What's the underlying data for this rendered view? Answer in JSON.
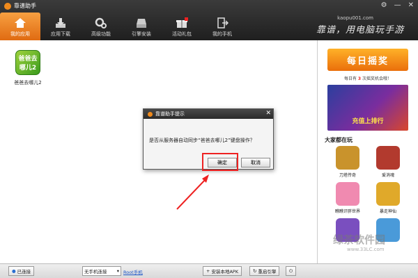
{
  "window": {
    "title": "靠谱助手",
    "controls": [
      "⚙",
      "—",
      "✕"
    ],
    "site": "kaopu001.com",
    "slogan": "靠谱，用电脑玩手游"
  },
  "toolbar": {
    "items": [
      {
        "label": "我的应用",
        "icon": "home-icon",
        "active": true
      },
      {
        "label": "应用下载",
        "icon": "download-icon"
      },
      {
        "label": "高级功能",
        "icon": "gear-icon"
      },
      {
        "label": "引擎安装",
        "icon": "install-icon"
      },
      {
        "label": "活动礼包",
        "icon": "gift-icon"
      },
      {
        "label": "我的手机",
        "icon": "phone-exit-icon"
      }
    ]
  },
  "apps": [
    {
      "name": "爸爸去哪儿2",
      "icon_text": "爸爸去哪儿2"
    }
  ],
  "dialog": {
    "title": "靠谱助手提示",
    "message": "是否从服务器自动同步“爸爸去哪儿2”键盘操作？",
    "ok": "确定",
    "cancel": "取消"
  },
  "sidebar": {
    "daily_button": "每日摇奖",
    "daily_note_prefix": "每日有",
    "daily_note_count": "3",
    "daily_note_suffix": "次摇奖机会哦！",
    "banner_text": "充值上排行",
    "popular_heading": "大家都在玩",
    "games": [
      {
        "name": "刀塔传奇",
        "color": "#c9932c"
      },
      {
        "name": "爱消魂",
        "color": "#b23a2e"
      },
      {
        "name": "瞧瞧讦胖世界",
        "color": "#f08ab0"
      },
      {
        "name": "暴走神仙",
        "color": "#e0a92a"
      },
      {
        "name": "",
        "color": "#7a4fbf"
      },
      {
        "name": "",
        "color": "#4a9ad9"
      }
    ]
  },
  "watermark": {
    "main": "绿茶软件园",
    "sub": "www.33LC.com"
  },
  "status": {
    "connected": "已连接",
    "device_select": "无手机连接",
    "root_link": "Root手机",
    "install_apk": "安装本地APK",
    "restart_engine": "重启引擎"
  }
}
